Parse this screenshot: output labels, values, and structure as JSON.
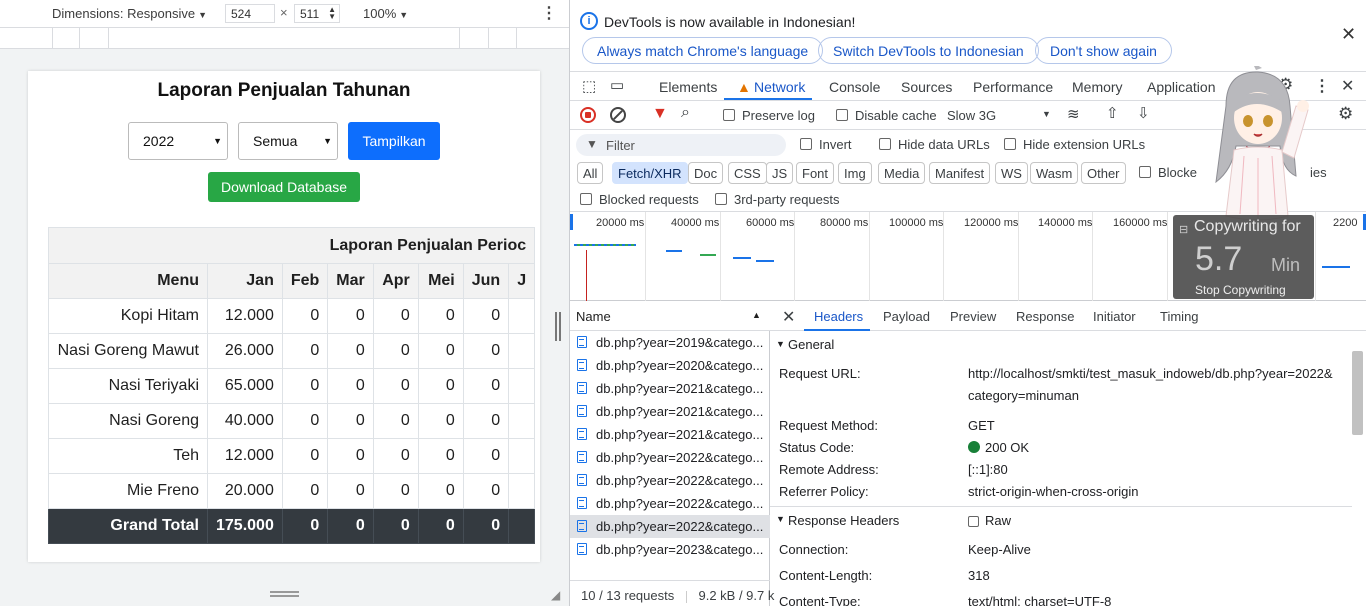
{
  "device_toolbar": {
    "dimensions_label": "Dimensions: Responsive",
    "width": "524",
    "height": "511",
    "zoom": "100%"
  },
  "page": {
    "title": "Laporan Penjualan Tahunan",
    "year_select": "2022",
    "category_select": "Semua",
    "show_button": "Tampilkan",
    "download_button": "Download Database",
    "table_period_header": "Laporan Penjualan Perioc",
    "columns": [
      "Menu",
      "Jan",
      "Feb",
      "Mar",
      "Apr",
      "Mei",
      "Jun",
      "J"
    ],
    "rows": [
      {
        "menu": "Kopi Hitam",
        "values": [
          "12.000",
          "0",
          "0",
          "0",
          "0",
          "0"
        ]
      },
      {
        "menu": "Nasi Goreng Mawut",
        "values": [
          "26.000",
          "0",
          "0",
          "0",
          "0",
          "0"
        ]
      },
      {
        "menu": "Nasi Teriyaki",
        "values": [
          "65.000",
          "0",
          "0",
          "0",
          "0",
          "0"
        ]
      },
      {
        "menu": "Nasi Goreng",
        "values": [
          "40.000",
          "0",
          "0",
          "0",
          "0",
          "0"
        ]
      },
      {
        "menu": "Teh",
        "values": [
          "12.000",
          "0",
          "0",
          "0",
          "0",
          "0"
        ]
      },
      {
        "menu": "Mie Freno",
        "values": [
          "20.000",
          "0",
          "0",
          "0",
          "0",
          "0"
        ]
      }
    ],
    "total": {
      "label": "Grand Total",
      "values": [
        "175.000",
        "0",
        "0",
        "0",
        "0",
        "0"
      ]
    }
  },
  "devtools": {
    "info": {
      "text": "DevTools is now available in Indonesian!",
      "btn_match": "Always match Chrome's language",
      "btn_switch": "Switch DevTools to Indonesian",
      "btn_dont": "Don't show again"
    },
    "tabs": [
      "Elements",
      "Network",
      "Console",
      "Sources",
      "Performance",
      "Memory",
      "Application"
    ],
    "toolbar": {
      "preserve_log": "Preserve log",
      "disable_cache": "Disable cache",
      "throttle": "Slow 3G"
    },
    "filter": {
      "placeholder": "Filter",
      "invert": "Invert",
      "hide_data": "Hide data URLs",
      "hide_ext": "Hide extension URLs"
    },
    "types": [
      "All",
      "Fetch/XHR",
      "Doc",
      "CSS",
      "JS",
      "Font",
      "Img",
      "Media",
      "Manifest",
      "WS",
      "Wasm",
      "Other"
    ],
    "blocked_cookies": "Blocked response cookies",
    "blocked_cookies_visible_a": "Blocke",
    "blocked_cookies_visible_b": "ies",
    "blocked_requests": "Blocked requests",
    "third_party": "3rd-party requests",
    "timeline_labels": [
      "20000 ms",
      "40000 ms",
      "60000 ms",
      "80000 ms",
      "100000 ms",
      "120000 ms",
      "140000 ms",
      "160000 ms",
      "2200"
    ],
    "name_header": "Name",
    "requests": [
      "db.php?year=2019&catego...",
      "db.php?year=2020&catego...",
      "db.php?year=2021&catego...",
      "db.php?year=2021&catego...",
      "db.php?year=2021&catego...",
      "db.php?year=2022&catego...",
      "db.php?year=2022&catego...",
      "db.php?year=2022&catego...",
      "db.php?year=2022&catego...",
      "db.php?year=2023&catego..."
    ],
    "footer_requests": "10 / 13 requests",
    "footer_size": "9.2 kB / 9.7 k",
    "detail_tabs": [
      "Headers",
      "Payload",
      "Preview",
      "Response",
      "Initiator",
      "Timing"
    ],
    "general_title": "General",
    "general": [
      {
        "key": "Request URL:",
        "value": "http://localhost/smkti/test_masuk_indoweb/db.php?year=2022&",
        "value2": "category=minuman"
      },
      {
        "key": "Request Method:",
        "value": "GET"
      },
      {
        "key": "Status Code:",
        "value": "200 OK"
      },
      {
        "key": "Remote Address:",
        "value": "[::1]:80"
      },
      {
        "key": "Referrer Policy:",
        "value": "strict-origin-when-cross-origin"
      }
    ],
    "response_headers_title": "Response Headers",
    "raw_label": "Raw",
    "response": [
      {
        "key": "Connection:",
        "value": "Keep-Alive"
      },
      {
        "key": "Content-Length:",
        "value": "318"
      },
      {
        "key": "Content-Type:",
        "value": "text/html; charset=UTF-8"
      }
    ]
  },
  "overlay": {
    "title": "Copywriting for",
    "number": "5.7",
    "unit": "Min",
    "stop": "Stop Copywriting"
  },
  "colors": {
    "accent": "#1a73e8",
    "primary_btn": "#0d6efd",
    "success_btn": "#28a745",
    "total_row": "#343a40",
    "record_red": "#d93025"
  }
}
